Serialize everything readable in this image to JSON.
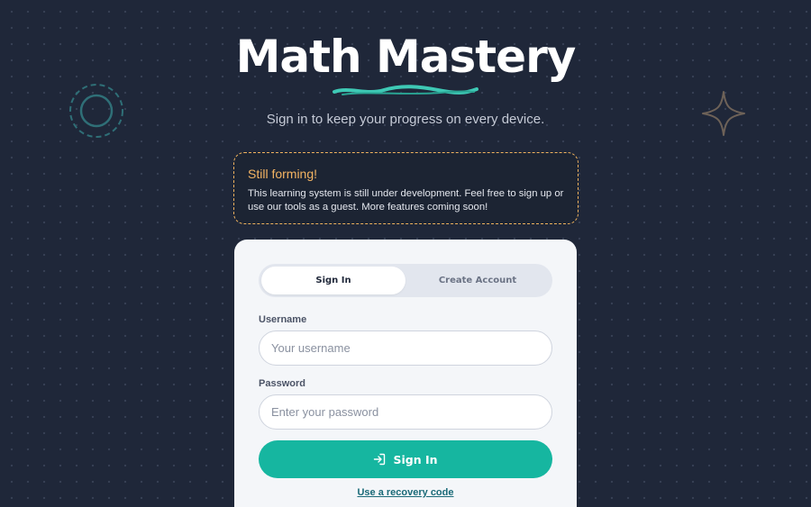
{
  "brand": {
    "title": "Math Mastery",
    "subtitle": "Sign in to keep your progress on every device."
  },
  "notice": {
    "title": "Still forming!",
    "body": "This learning system is still under development. Feel free to sign up or use our tools as a guest. More features coming soon!"
  },
  "auth": {
    "tabs": [
      {
        "label": "Sign In",
        "active": true
      },
      {
        "label": "Create Account",
        "active": false
      }
    ],
    "username": {
      "label": "Username",
      "placeholder": "Your username",
      "value": ""
    },
    "password": {
      "label": "Password",
      "placeholder": "Enter your password",
      "value": ""
    },
    "submit_label": "Sign In",
    "submit_icon": "login-arrow-icon",
    "recovery_link": "Use a recovery code"
  },
  "decorations": {
    "left_icon": "ring-icon",
    "right_icon": "sparkle-star-icon"
  },
  "colors": {
    "background": "#1f2739",
    "accent": "#16b6a0",
    "notice_border": "#f0b35e",
    "card": "#f4f6f9",
    "squiggle": "#3ec9b5"
  }
}
